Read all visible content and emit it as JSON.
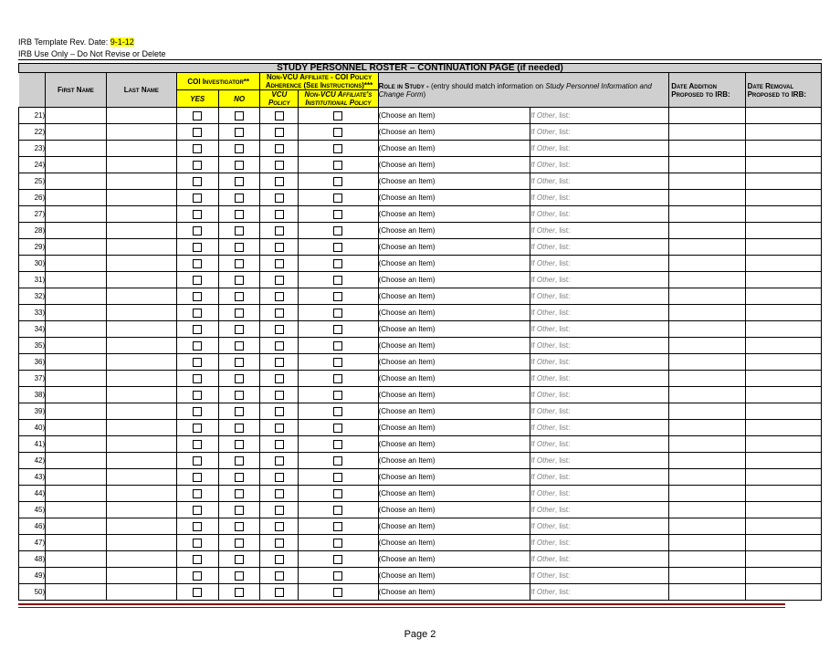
{
  "header": {
    "rev_prefix": "IRB Template Rev. Date: ",
    "rev_date": "9-1-12",
    "use_only": "IRB Use Only – Do Not Revise or Delete",
    "title": "STUDY PERSONNEL ROSTER – CONTINUATION PAGE (if needed)"
  },
  "columns": {
    "first_name": "First Name",
    "last_name": "Last Name",
    "coi_header": "COI  Investigator**",
    "nonvcu_header": "Non-VCU Affiliate - COI Policy Adherence (See Instructions)***",
    "yes": "YES",
    "no": "NO",
    "vcu_policy": "VCU Policy",
    "nonvcu_policy": "Non-VCU Affiliate's Institutional Policy",
    "role_label": "Role in Study - ",
    "role_desc": "(entry should match information on ",
    "role_desc_it": "Study Personnel Information and Change Form",
    "role_desc_close": ")",
    "date_add": "Date Addition Proposed to IRB:",
    "date_rem": "Date Removal Proposed to IRB:"
  },
  "row_start": 21,
  "row_end": 50,
  "row_text": {
    "choose": "(Choose an Item)",
    "ifother_prefix": "If ",
    "ifother_it": "Other",
    "ifother_suffix": ", list:"
  },
  "footer": {
    "page": "Page 2"
  }
}
